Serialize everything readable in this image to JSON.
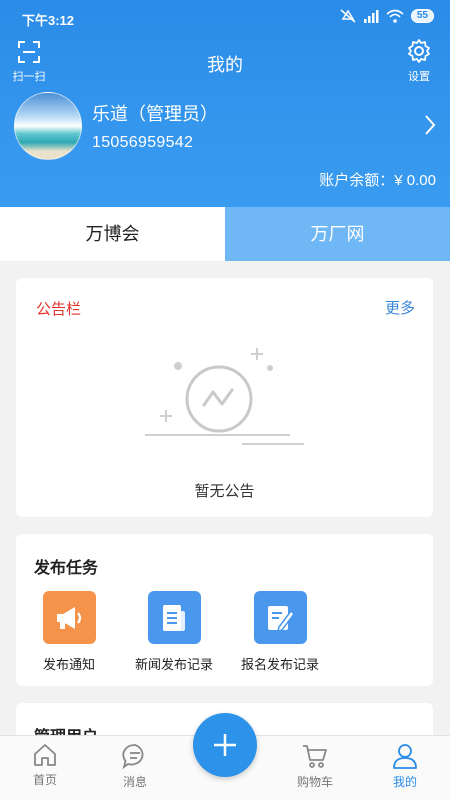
{
  "status_bar": {
    "time": "下午3:12",
    "battery": "55"
  },
  "header": {
    "scan_label": "扫一扫",
    "title": "我的",
    "settings_label": "设置",
    "username": "乐道（管理员）",
    "phone": "15056959542",
    "balance": "账户余额：¥ 0.00"
  },
  "tabs": [
    {
      "label": "万博会"
    },
    {
      "label": "万厂网"
    }
  ],
  "notice": {
    "title": "公告栏",
    "more": "更多",
    "empty_text": "暂无公告"
  },
  "tasks": {
    "title": "发布任务",
    "items": [
      {
        "label": "发布通知",
        "icon": "megaphone-icon",
        "color": "#f5934a"
      },
      {
        "label": "新闻发布记录",
        "icon": "news-doc-icon",
        "color": "#4a97ee"
      },
      {
        "label": "报名发布记录",
        "icon": "edit-doc-icon",
        "color": "#4a97ee"
      }
    ]
  },
  "manage": {
    "title": "管理用户"
  },
  "tabbar": {
    "items": [
      {
        "label": "首页",
        "icon": "home-icon"
      },
      {
        "label": "消息",
        "icon": "chat-icon"
      },
      {
        "label": "购物车",
        "icon": "cart-icon"
      },
      {
        "label": "我的",
        "icon": "user-icon"
      }
    ],
    "active": "我的"
  },
  "colors": {
    "brand": "#2a8ce8",
    "notice_title": "#e0342c",
    "link": "#3a87d8"
  }
}
